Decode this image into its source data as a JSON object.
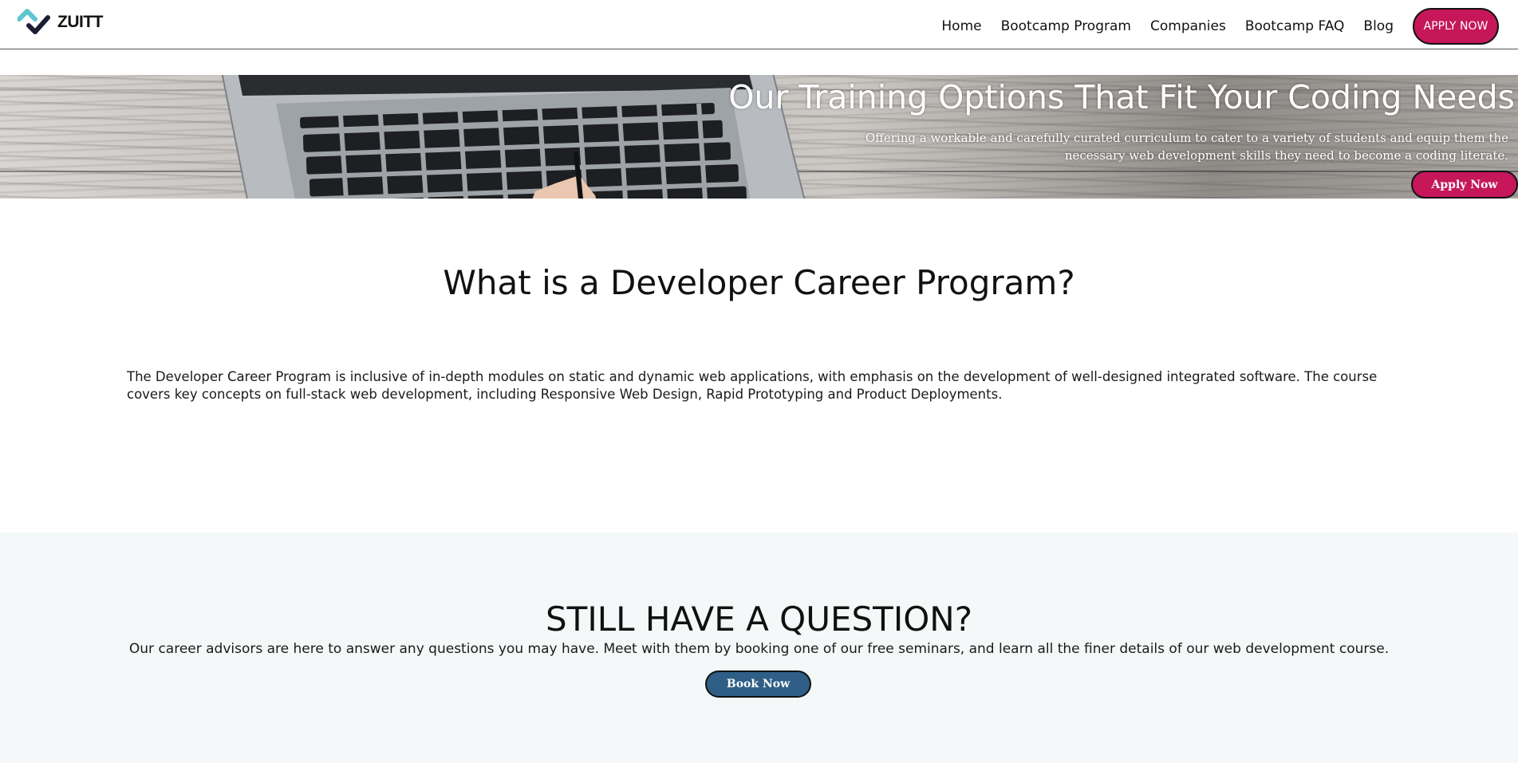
{
  "brand": {
    "logo_text": "ZUITT",
    "colors": {
      "accent": "#c5175a",
      "secondary": "#2f5f86",
      "logo_teal": "#5cc6cf",
      "logo_dark": "#1b1e33"
    }
  },
  "nav": {
    "links": [
      {
        "label": "Home"
      },
      {
        "label": "Bootcamp Program"
      },
      {
        "label": "Companies"
      },
      {
        "label": "Bootcamp FAQ"
      },
      {
        "label": "Blog"
      }
    ],
    "apply_label": "APPLY NOW"
  },
  "hero": {
    "title": "Our Training Options That Fit Your Coding Needs",
    "subtitle": "Offering a workable and carefully curated curriculum to cater to a variety of students and equip them the necessary web development skills they need to become a coding literate.",
    "apply_label": "Apply Now"
  },
  "program": {
    "title": "What is a Developer Career Program?",
    "body": "The Developer Career Program is inclusive of in-depth modules on static and dynamic web applications, with emphasis on the development of well-designed integrated software. The course covers key concepts on full-stack web development, including Responsive Web Design, Rapid Prototyping and Product Deployments."
  },
  "question": {
    "title": "STILL HAVE A QUESTION?",
    "body": "Our career advisors are here to answer any questions you may have. Meet with them by booking one of our free seminars, and learn all the finer details of our web development course.",
    "book_label": "Book Now"
  }
}
